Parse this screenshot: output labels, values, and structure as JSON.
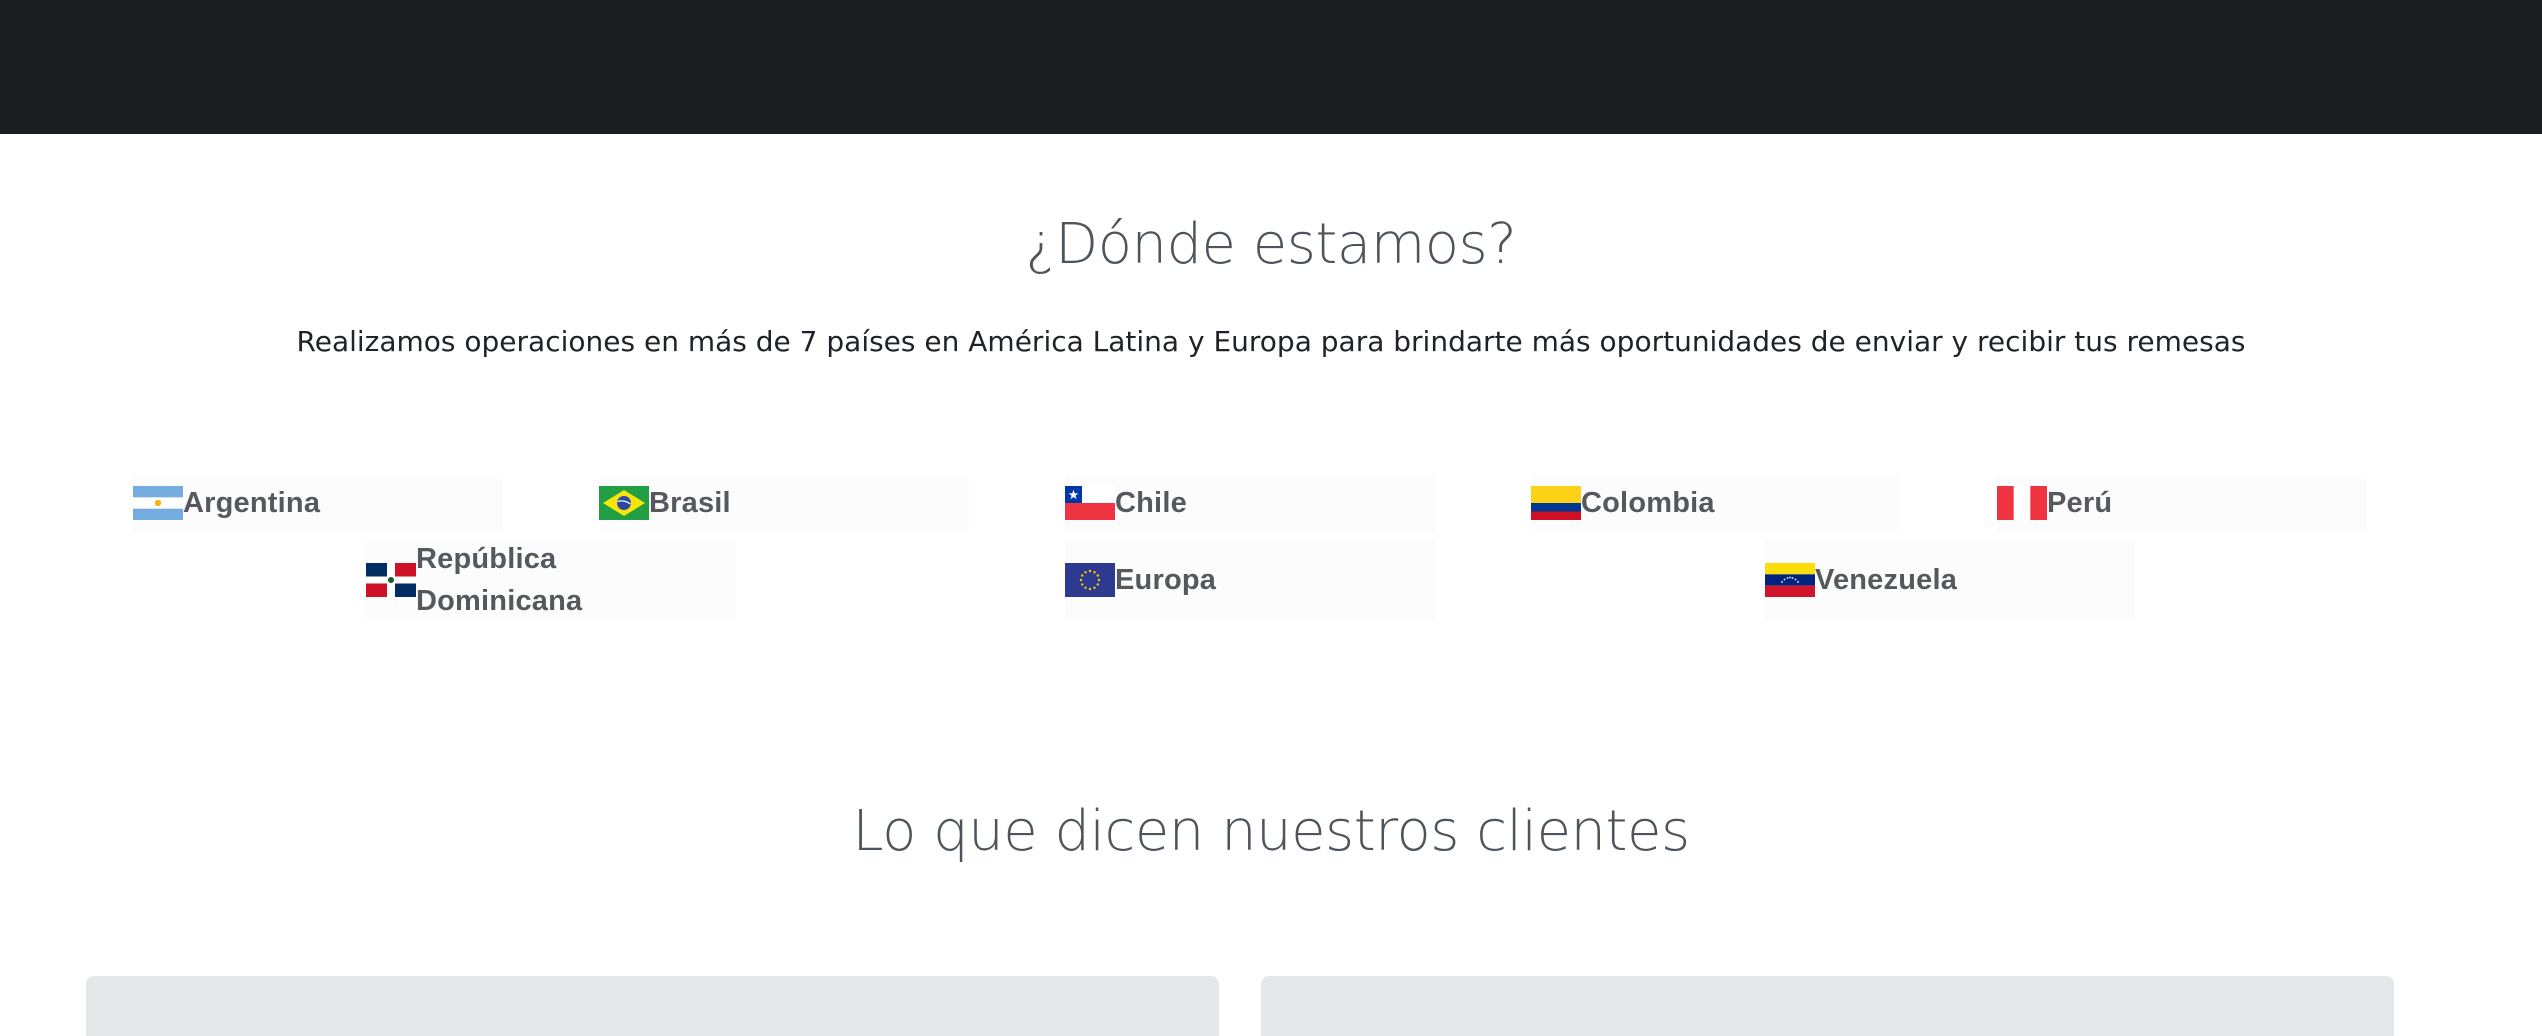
{
  "where": {
    "title": "¿Dónde estamos?",
    "subtitle": "Realizamos operaciones en más de 7 países en América Latina y Europa para brindarte más oportunidades de enviar y recibir tus remesas"
  },
  "countries": [
    {
      "name": "Argentina",
      "flag_icon": "argentina-flag-icon"
    },
    {
      "name": "Brasil",
      "flag_icon": "brazil-flag-icon"
    },
    {
      "name": "Chile",
      "flag_icon": "chile-flag-icon"
    },
    {
      "name": "Colombia",
      "flag_icon": "colombia-flag-icon"
    },
    {
      "name": "Perú",
      "flag_icon": "peru-flag-icon"
    },
    {
      "name": "República Dominicana",
      "flag_icon": "dominican-republic-flag-icon"
    },
    {
      "name": "Europa",
      "flag_icon": "european-union-flag-icon"
    },
    {
      "name": "Venezuela",
      "flag_icon": "venezuela-flag-icon"
    }
  ],
  "testimonials": {
    "title": "Lo que dicen nuestros clientes"
  },
  "colors": {
    "topbar": "#1b1e21",
    "heading": "#4d545c",
    "country_text": "#55595e",
    "card_bg": "#e6e7e9"
  }
}
